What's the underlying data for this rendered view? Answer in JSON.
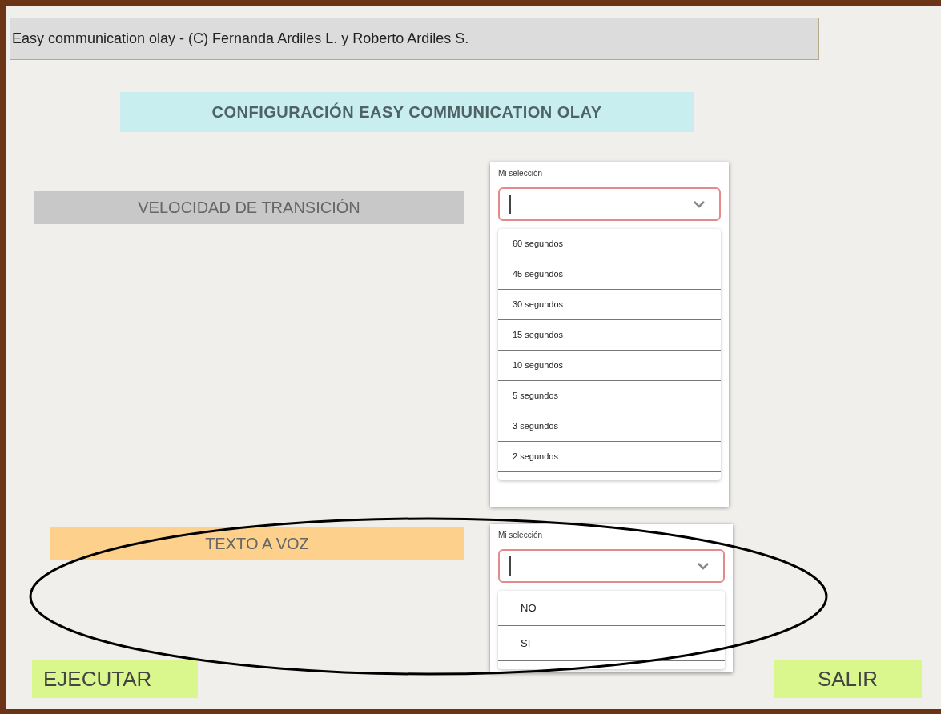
{
  "header": {
    "text": "Easy communication olay - (C) Fernanda Ardiles L. y Roberto Ardiles S."
  },
  "title": "CONFIGURACIÓN EASY COMMUNICATION OLAY",
  "sections": [
    {
      "label": "VELOCIDAD DE TRANSICIÓN",
      "color": "#c8c8c8",
      "dropdown": {
        "label": "Mi selección",
        "options": [
          "60 segundos",
          "45 segundos",
          "30 segundos",
          "15 segundos",
          "10 segundos",
          "5 segundos",
          "3 segundos",
          "2 segundos"
        ]
      }
    },
    {
      "label": "TEXTO A VOZ",
      "color": "#fdd08b",
      "dropdown": {
        "label": "Mi selección",
        "options": [
          "NO",
          "SI"
        ]
      }
    }
  ],
  "buttons": [
    "EJECUTAR",
    "SALIR"
  ]
}
